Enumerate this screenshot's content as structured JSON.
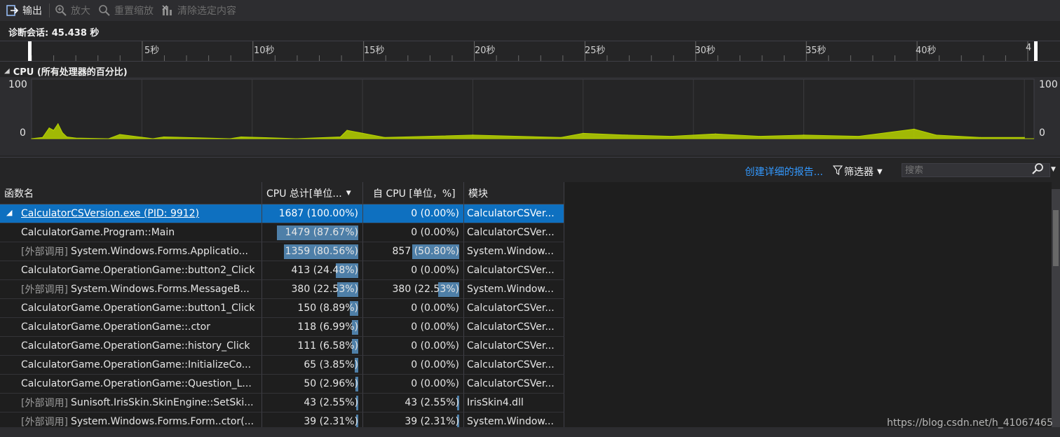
{
  "toolbar": {
    "export_label": "输出",
    "zoom_in_label": "放大",
    "reset_zoom_label": "重置缩放",
    "clear_selection_label": "清除选定内容"
  },
  "session": {
    "label": "诊断会话: 45.438 秒"
  },
  "ruler": {
    "ticks": [
      "5秒",
      "10秒",
      "15秒",
      "20秒",
      "25秒",
      "30秒",
      "35秒",
      "40秒",
      "4"
    ]
  },
  "cpu": {
    "title": "CPU (所有处理器的百分比)",
    "y_max_label": "100",
    "y_min_label": "0",
    "line_color": "#b7d400"
  },
  "chart_data": {
    "type": "area",
    "title": "CPU (所有处理器的百分比)",
    "xlabel": "",
    "ylabel": "",
    "ylim": [
      0,
      100
    ],
    "xlim": [
      0,
      45.438
    ],
    "x": [
      0,
      0.5,
      0.8,
      1.0,
      1.2,
      1.4,
      1.6,
      2.0,
      3.5,
      4.0,
      5.5,
      6.0,
      9.0,
      9.5,
      12.0,
      14.0,
      14.3,
      16.0,
      20.0,
      24.0,
      25.0,
      27.0,
      29.0,
      31.0,
      33.0,
      35.0,
      37.5,
      40.0,
      41.0,
      43.0,
      45.0
    ],
    "values": [
      0,
      2,
      18,
      14,
      25,
      10,
      3,
      1,
      0,
      7,
      0,
      3,
      0,
      3,
      0,
      3,
      14,
      2,
      6,
      2,
      9,
      6,
      4,
      8,
      4,
      6,
      4,
      16,
      6,
      2,
      2
    ]
  },
  "grid_toolbar": {
    "report_link": "创建详细的报告...",
    "filter_label": "筛选器",
    "search_placeholder": "搜索"
  },
  "table": {
    "columns": [
      "函数名",
      "CPU 总计[单位...",
      "自 CPU [单位，%]",
      "模块"
    ],
    "rows": [
      {
        "external": "",
        "name": "CalculatorCSVersion.exe (PID: 9912)",
        "total": "1687 (100.00%)",
        "total_pct": 100.0,
        "self": "0 (0.00%)",
        "self_pct": 0.0,
        "module": "CalculatorCSVer...",
        "selected": true
      },
      {
        "external": "",
        "name": "CalculatorGame.Program::Main",
        "total": "1479 (87.67%)",
        "total_pct": 87.67,
        "self": "0 (0.00%)",
        "self_pct": 0.0,
        "module": "CalculatorCSVer..."
      },
      {
        "external": "[外部调用]",
        "name": "System.Windows.Forms.Applicatio...",
        "total": "1359 (80.56%)",
        "total_pct": 80.56,
        "self": "857 (50.80%)",
        "self_pct": 50.8,
        "module": "System.Window..."
      },
      {
        "external": "",
        "name": "CalculatorGame.OperationGame::button2_Click",
        "total": "413 (24.48%)",
        "total_pct": 24.48,
        "self": "0 (0.00%)",
        "self_pct": 0.0,
        "module": "CalculatorCSVer..."
      },
      {
        "external": "[外部调用]",
        "name": "System.Windows.Forms.MessageB...",
        "total": "380 (22.53%)",
        "total_pct": 22.53,
        "self": "380 (22.53%)",
        "self_pct": 22.53,
        "module": "System.Window..."
      },
      {
        "external": "",
        "name": "CalculatorGame.OperationGame::button1_Click",
        "total": "150 (8.89%)",
        "total_pct": 8.89,
        "self": "0 (0.00%)",
        "self_pct": 0.0,
        "module": "CalculatorCSVer..."
      },
      {
        "external": "",
        "name": "CalculatorGame.OperationGame::.ctor",
        "total": "118 (6.99%)",
        "total_pct": 6.99,
        "self": "0 (0.00%)",
        "self_pct": 0.0,
        "module": "CalculatorCSVer..."
      },
      {
        "external": "",
        "name": "CalculatorGame.OperationGame::history_Click",
        "total": "111 (6.58%)",
        "total_pct": 6.58,
        "self": "0 (0.00%)",
        "self_pct": 0.0,
        "module": "CalculatorCSVer..."
      },
      {
        "external": "",
        "name": "CalculatorGame.OperationGame::InitializeCo...",
        "total": "65 (3.85%)",
        "total_pct": 3.85,
        "self": "0 (0.00%)",
        "self_pct": 0.0,
        "module": "CalculatorCSVer..."
      },
      {
        "external": "",
        "name": "CalculatorGame.OperationGame::Question_L...",
        "total": "50 (2.96%)",
        "total_pct": 2.96,
        "self": "0 (0.00%)",
        "self_pct": 0.0,
        "module": "CalculatorCSVer..."
      },
      {
        "external": "[外部调用]",
        "name": "Sunisoft.IrisSkin.SkinEngine::SetSki...",
        "total": "43 (2.55%)",
        "total_pct": 2.55,
        "self": "43 (2.55%)",
        "self_pct": 2.55,
        "module": "IrisSkin4.dll"
      },
      {
        "external": "[外部调用]",
        "name": "System.Windows.Forms.Form..ctor(...",
        "total": "39 (2.31%)",
        "total_pct": 2.31,
        "self": "39 (2.31%)",
        "self_pct": 2.31,
        "module": "System.Window..."
      }
    ]
  },
  "watermark": "https://blog.csdn.net/h_41067465",
  "colors": {
    "accent": "#0e70c0",
    "bar": "#4e7fa8",
    "link": "#3399ff"
  }
}
